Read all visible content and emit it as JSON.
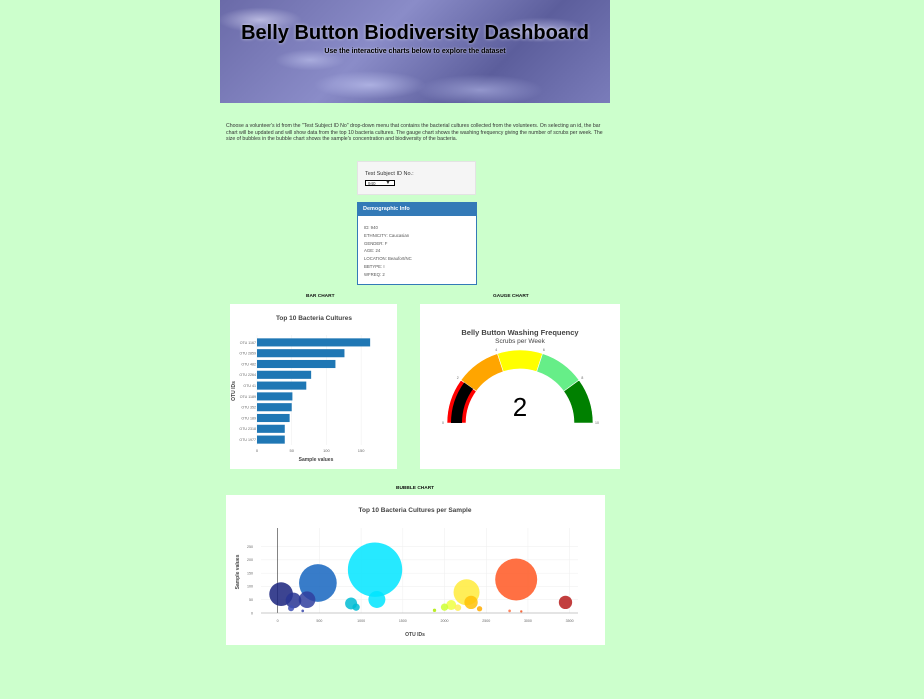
{
  "header": {
    "title": "Belly Button Biodiversity Dashboard",
    "tagline": "Use the interactive charts below to explore the dataset"
  },
  "intro_text": "Choose a volunteer's id from the \"Test Subject ID No\" drop-down menu that contains the bacterial cultures collected from the volunteers. On selecting an id, the bar chart will be updated and will show data from the top 10 bacteria cultures. The gauge chart shows the washing frequency giving the number of scrubs per week. The size of bubbles in the bubble chart shows the sample's concentration and biodiversity of the bacteria.",
  "selector": {
    "label": "Test Subject ID No.:",
    "value": "940"
  },
  "demographics": {
    "title": "Demographic Info",
    "lines": [
      "ID: 940",
      "ETHNICITY: Caucasian",
      "GENDER: F",
      "AGE: 24",
      "LOCATION: Beaufort/NC",
      "BBTYPE: I",
      "WFREQ: 2"
    ]
  },
  "sections": {
    "bar": "BAR CHART",
    "gauge": "GAUGE CHART",
    "bubble": "BUBBLE CHART"
  },
  "colors": {
    "page_bg": "#ccffcc",
    "bar": "#1f77b4",
    "panel_head": "#337ab7"
  },
  "chart_data": [
    {
      "type": "bar",
      "orientation": "horizontal",
      "title": "Top 10 Bacteria Cultures",
      "xlabel": "Sample values",
      "ylabel": "OTU IDs",
      "categories": [
        "OTU 1167",
        "OTU 2859",
        "OTU 482",
        "OTU 2264",
        "OTU 41",
        "OTU 1189",
        "OTU 352",
        "OTU 189",
        "OTU 2318",
        "OTU 1977"
      ],
      "values": [
        163,
        126,
        113,
        78,
        71,
        51,
        50,
        47,
        40,
        40
      ],
      "xticks": [
        "0",
        "50",
        "100",
        "150"
      ],
      "xlim": [
        0,
        170
      ]
    },
    {
      "type": "gauge",
      "title": "Belly Button Washing Frequency",
      "subtitle": "Scrubs per Week",
      "value": 2,
      "range": [
        0,
        10
      ],
      "tick_labels": [
        "0",
        "2",
        "4",
        "6",
        "8",
        "10"
      ],
      "band_colors": [
        "#ff0000",
        "#ffa500",
        "#ffff00",
        "#66ee88",
        "#008000"
      ]
    },
    {
      "type": "scatter",
      "subtype": "bubble",
      "title": "Top 10 Bacteria Cultures per Sample",
      "xlabel": "OTU IDs",
      "ylabel": "Sample values",
      "xlim": [
        -200,
        3600
      ],
      "ylim": [
        0,
        320
      ],
      "xticks": [
        0,
        500,
        1000,
        1500,
        2000,
        2500,
        3000,
        3500
      ],
      "yticks": [
        0,
        50,
        100,
        150,
        200,
        250
      ],
      "points": [
        {
          "x": 41,
          "y": 71,
          "c": "#1a237e"
        },
        {
          "x": 189,
          "y": 47,
          "c": "#283593"
        },
        {
          "x": 352,
          "y": 50,
          "c": "#303f9f"
        },
        {
          "x": 482,
          "y": 113,
          "c": "#1565c0"
        },
        {
          "x": 1167,
          "y": 163,
          "c": "#00e5ff"
        },
        {
          "x": 1189,
          "y": 51,
          "c": "#00e5ff"
        },
        {
          "x": 880,
          "y": 36,
          "c": "#00bcd4"
        },
        {
          "x": 940,
          "y": 22,
          "c": "#00bcd4"
        },
        {
          "x": 2264,
          "y": 78,
          "c": "#ffeb3b"
        },
        {
          "x": 2318,
          "y": 40,
          "c": "#ffc107"
        },
        {
          "x": 2859,
          "y": 126,
          "c": "#ff5722"
        },
        {
          "x": 3450,
          "y": 40,
          "c": "#b71c1c"
        },
        {
          "x": 160,
          "y": 18,
          "c": "#3f51b5"
        },
        {
          "x": 300,
          "y": 8,
          "c": "#3949ab"
        },
        {
          "x": 1880,
          "y": 10,
          "c": "#aeea00"
        },
        {
          "x": 2000,
          "y": 22,
          "c": "#ccff33"
        },
        {
          "x": 2080,
          "y": 30,
          "c": "#eeff41"
        },
        {
          "x": 2160,
          "y": 20,
          "c": "#ffee58"
        },
        {
          "x": 2420,
          "y": 16,
          "c": "#ffab00"
        },
        {
          "x": 2780,
          "y": 8,
          "c": "#ff7043"
        },
        {
          "x": 2920,
          "y": 6,
          "c": "#f4511e"
        }
      ]
    }
  ]
}
